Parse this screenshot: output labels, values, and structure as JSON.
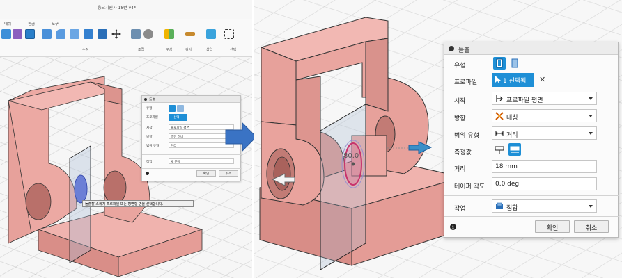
{
  "left": {
    "doc_title": "응요기원사 18번 v4*",
    "toolbar_tabs": [
      "메쉬",
      "판금",
      "도구"
    ],
    "toolbar_groups": [
      "수정",
      "조립",
      "구성",
      "검사",
      "삽입",
      "선택"
    ],
    "mini_dialog": {
      "title": "돌출",
      "rows": [
        {
          "label": "유형",
          "value": ""
        },
        {
          "label": "프로파일",
          "value": "선택"
        },
        {
          "label": "시작",
          "value": "프로파일 평면"
        },
        {
          "label": "방향",
          "value": "측면 하나"
        },
        {
          "label": "범위 유형",
          "value": "거리"
        },
        {
          "label": "작업",
          "value": "새 본체"
        }
      ],
      "ok": "확인",
      "cancel": "취소"
    },
    "tooltip": "돌출할 스케치 프로파일 또는 평면형 면을 선택합니다."
  },
  "right": {
    "dimension_label": "80.0",
    "dialog": {
      "title": "돌출",
      "type_label": "유형",
      "profile_label": "프로파일",
      "profile_value": "1 선택됨",
      "clear": "✕",
      "start_label": "시작",
      "start_value": "프로파일 평면",
      "direction_label": "방향",
      "direction_value": "대칭",
      "extent_label": "범위 유형",
      "extent_value": "거리",
      "measure_label": "측정값",
      "distance_label": "거리",
      "distance_value": "18 mm",
      "taper_label": "테이퍼 각도",
      "taper_value": "0.0 deg",
      "operation_label": "작업",
      "operation_value": "접합",
      "ok": "확인",
      "cancel": "취소"
    }
  },
  "colors": {
    "body": "#e8a09b",
    "body_dark": "#c98580",
    "accent_blue": "#1e8fd6",
    "arrow_blue": "#3a73c4"
  }
}
